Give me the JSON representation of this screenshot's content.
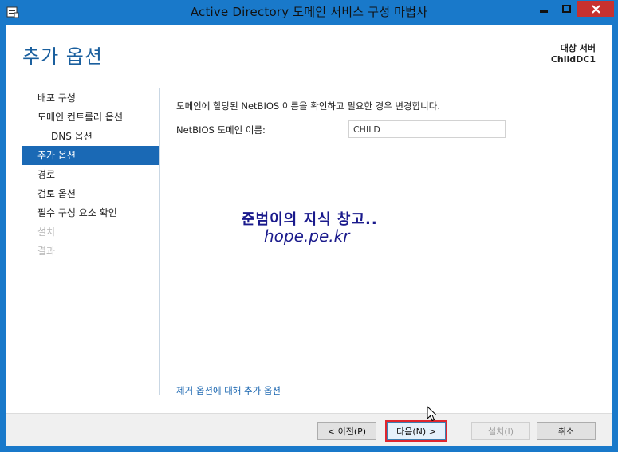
{
  "window": {
    "title": "Active Directory 도메인 서비스 구성 마법사"
  },
  "header": {
    "page_title": "추가 옵션",
    "target_label": "대상 서버",
    "target_server": "ChildDC1"
  },
  "nav": {
    "items": [
      {
        "label": "배포 구성",
        "state": "normal"
      },
      {
        "label": "도메인 컨트롤러 옵션",
        "state": "normal"
      },
      {
        "label": "DNS 옵션",
        "state": "sub"
      },
      {
        "label": "추가 옵션",
        "state": "active"
      },
      {
        "label": "경로",
        "state": "normal"
      },
      {
        "label": "검토 옵션",
        "state": "normal"
      },
      {
        "label": "필수 구성 요소 확인",
        "state": "normal"
      },
      {
        "label": "설치",
        "state": "disabled"
      },
      {
        "label": "결과",
        "state": "disabled"
      }
    ]
  },
  "content": {
    "description": "도메인에 할당된 NetBIOS 이름을 확인하고 필요한 경우 변경합니다.",
    "netbios_label": "NetBIOS 도메인 이름:",
    "netbios_value": "CHILD",
    "more_link": "제거 옵션에 대해 추가 옵션"
  },
  "watermark": {
    "line1": "준범이의 지식 창고..",
    "line2": "hope.pe.kr"
  },
  "footer": {
    "prev_label": "< 이전(P)",
    "next_label": "다음(N) >",
    "install_label": "설치(I)",
    "cancel_label": "취소"
  },
  "colors": {
    "frame": "#1979ca",
    "active_nav": "#1a69b5",
    "title_text": "#1a5f9e",
    "close_button": "#c7312f",
    "highlight": "#e0262e"
  }
}
